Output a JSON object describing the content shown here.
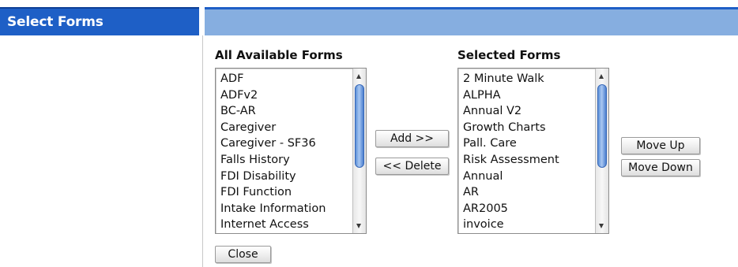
{
  "header": {
    "title": "Select Forms"
  },
  "available": {
    "title": "All Available Forms",
    "items": [
      "ADF",
      "ADFv2",
      "BC-AR",
      "Caregiver",
      "Caregiver - SF36",
      "Falls History",
      "FDI Disability",
      "FDI Function",
      "Intake Information",
      "Internet Access"
    ]
  },
  "selected": {
    "title": "Selected Forms",
    "items": [
      "2 Minute Walk",
      "ALPHA",
      "Annual V2",
      "Growth Charts",
      "Pall. Care",
      "Risk Assessment",
      "Annual",
      "AR",
      "AR2005",
      "invoice"
    ]
  },
  "buttons": {
    "add": "Add >>",
    "delete": "<< Delete",
    "move_up": "Move Up",
    "move_down": "Move Down",
    "close": "Close"
  },
  "colors": {
    "header_dark": "#1e5fc6",
    "header_light": "#86aee0",
    "scroll_thumb": "#5b8fd8"
  },
  "icons": {
    "scroll_up": "arrow-up-icon",
    "scroll_down": "arrow-down-icon"
  }
}
